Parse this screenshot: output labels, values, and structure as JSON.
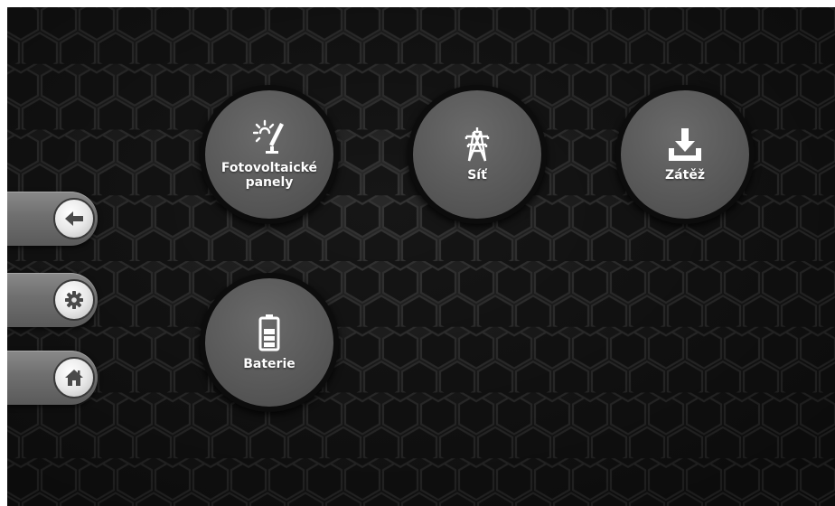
{
  "menu": {
    "pv": {
      "label_line1": "Fotovoltaické",
      "label_line2": "panely",
      "icon": "solar-panel-icon"
    },
    "grid": {
      "label": "Síť",
      "icon": "power-pylon-icon"
    },
    "load": {
      "label": "Zátěž",
      "icon": "download-icon"
    },
    "battery": {
      "label": "Baterie",
      "icon": "battery-icon"
    }
  },
  "side_nav": {
    "items": [
      {
        "icon": "arrow-left-icon"
      },
      {
        "icon": "gear-icon"
      },
      {
        "icon": "home-icon"
      }
    ]
  },
  "colors": {
    "background": "#1b1b1b",
    "button_face": "#5e5e5e",
    "button_ring": "#0c0c0c",
    "label": "#ffffff"
  }
}
